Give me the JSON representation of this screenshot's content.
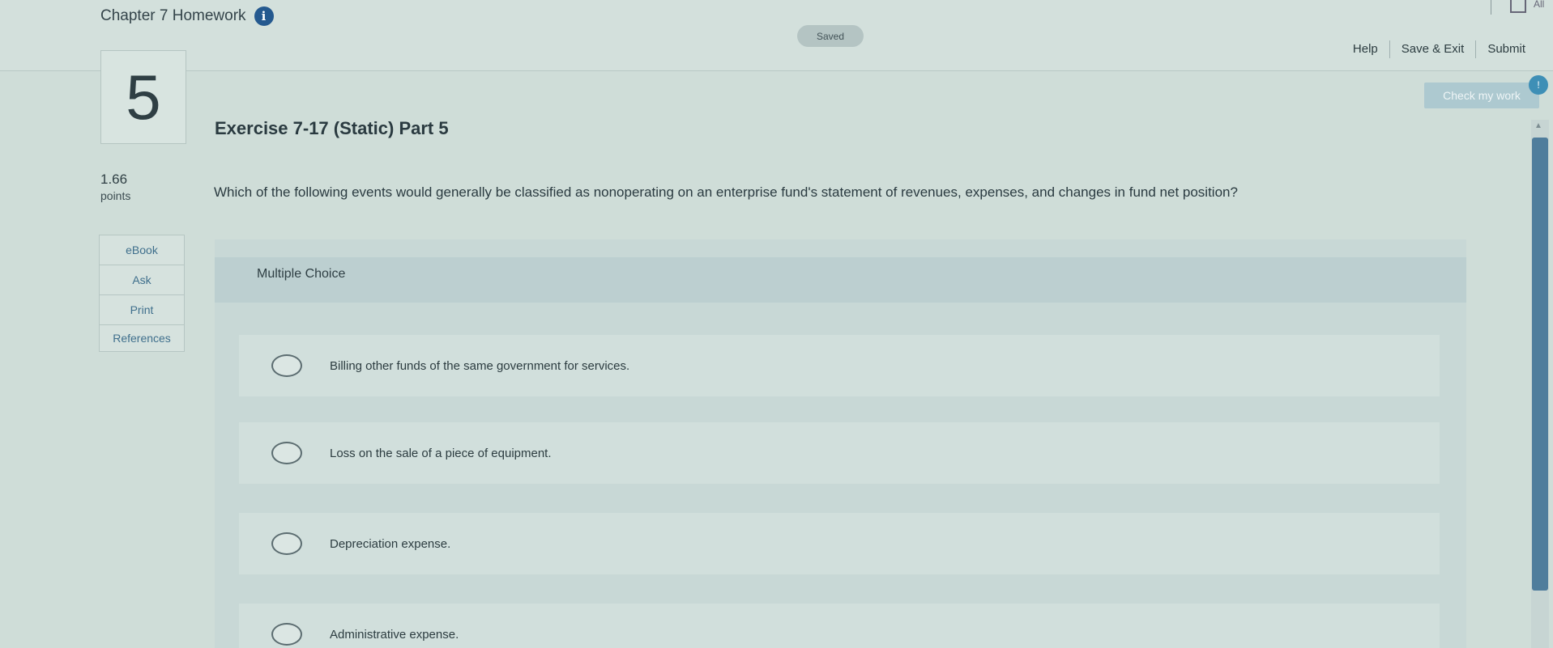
{
  "header": {
    "doc_title": "Chapter 7 Homework",
    "info_icon": "i",
    "saved": "Saved",
    "corner_label": "All",
    "actions": [
      "Help",
      "Save & Exit",
      "Submit"
    ]
  },
  "question": {
    "number": "5",
    "title": "Exercise 7-17 (Static) Part 5",
    "points_value": "1.66",
    "points_label": "points",
    "prompt": "Which of the following events would generally be classified as nonoperating on an enterprise fund's statement of revenues, expenses, and changes in fund net position?",
    "check_button": "Check my work",
    "check_badge": "!"
  },
  "tools": [
    "eBook",
    "Ask",
    "Print",
    "References"
  ],
  "multiple_choice": {
    "label": "Multiple Choice",
    "options": [
      "Billing other funds of the same government for services.",
      "Loss on the sale of a piece of equipment.",
      "Depreciation expense.",
      "Administrative expense."
    ]
  }
}
